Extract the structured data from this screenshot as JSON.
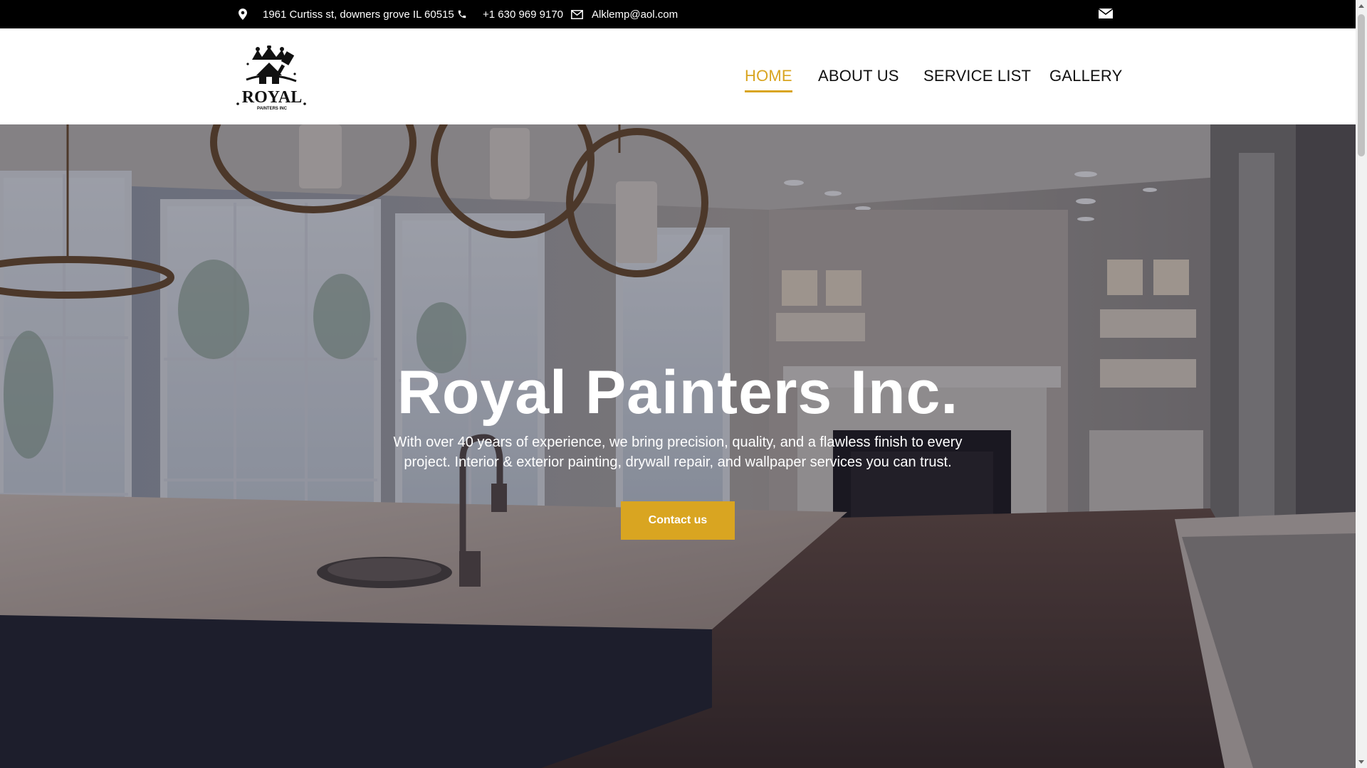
{
  "topbar": {
    "address": "1961 Curtiss st, downers grove IL 60515",
    "phone": "+1 630 969 9170",
    "email": "Alklemp@aol.com",
    "icons": [
      "map-pin-icon",
      "phone-icon",
      "envelope-icon",
      "mail-icon"
    ]
  },
  "logo": {
    "word": "ROYAL",
    "subtitle": "PAINTERS INC"
  },
  "nav": {
    "items": [
      {
        "label": "HOME",
        "active": true
      },
      {
        "label": "ABOUT US",
        "active": false
      },
      {
        "label": "SERVICE LIST",
        "active": false
      },
      {
        "label": "GALLERY",
        "active": false
      }
    ]
  },
  "hero": {
    "title": "Royal Painters Inc.",
    "subtitle": "With over 40 years of experience, we bring precision, quality, and a flawless finish to every project. Interior & exterior painting, drywall repair, and wallpaper services you can trust.",
    "button_label": "Contact us"
  },
  "colors": {
    "accent": "#d9a521",
    "topbar_bg": "#000000",
    "nav_text": "#111111"
  }
}
